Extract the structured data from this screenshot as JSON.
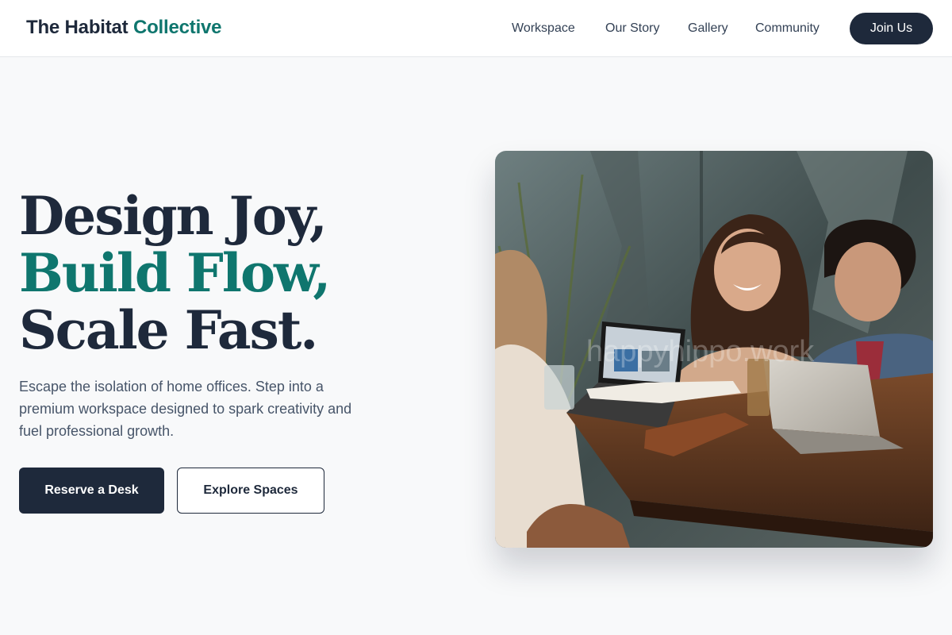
{
  "header": {
    "logo_main": "The Habitat",
    "logo_accent": "Collective",
    "nav": [
      "Workspace",
      "Our Story",
      "Gallery",
      "Community"
    ],
    "cta": "Join Us"
  },
  "hero": {
    "headline_line1": "Design Joy,",
    "headline_line2": "Build Flow,",
    "headline_line3": "Scale Fast.",
    "subtext": "Escape the isolation of home offices. Step into a premium workspace designed to spark creativity and fuel professional growth.",
    "primary_button": "Reserve a Desk",
    "secondary_button": "Explore Spaces",
    "image_watermark": "happyhippo.work",
    "image_alt": "people collaborating around a wooden table with laptops"
  },
  "colors": {
    "primary": "#1e293b",
    "accent": "#0f766e",
    "background": "#f8f9fa"
  }
}
